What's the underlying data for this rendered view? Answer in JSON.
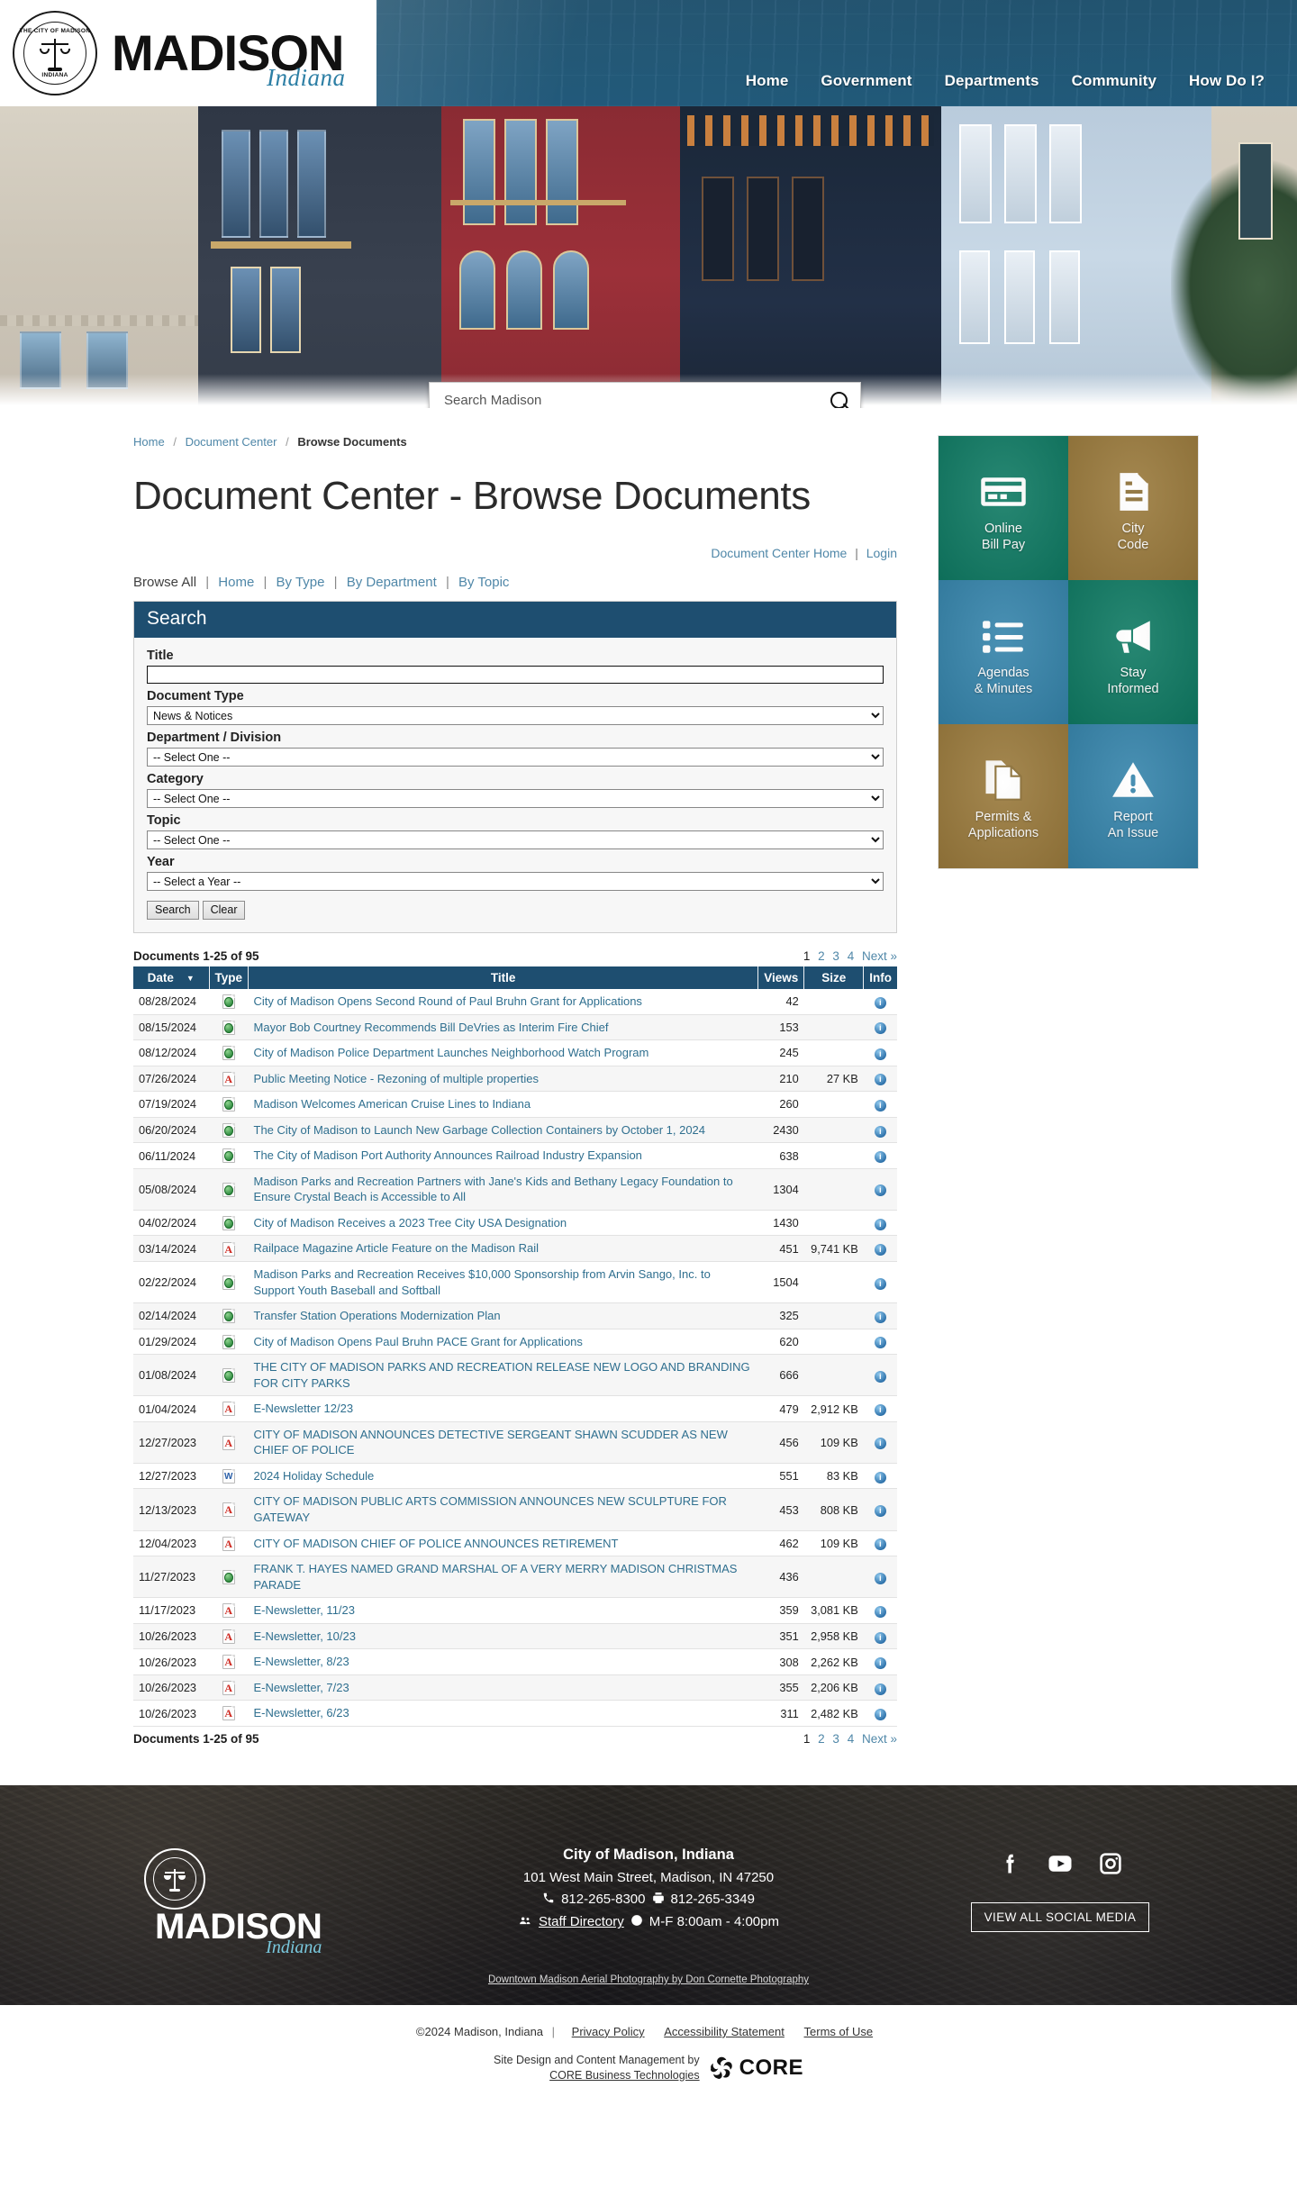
{
  "header": {
    "logo_title": "MADISON",
    "logo_subtitle": "Indiana",
    "seal_top_text": "THE CITY OF MADISON",
    "seal_bottom_text": "INDIANA",
    "nav": [
      {
        "label": "Home"
      },
      {
        "label": "Government"
      },
      {
        "label": "Departments"
      },
      {
        "label": "Community"
      },
      {
        "label": "How Do I?"
      }
    ]
  },
  "hero": {
    "search_placeholder": "Search Madison",
    "search_value": "",
    "search_icon": "search-icon"
  },
  "breadcrumb": {
    "items": [
      {
        "label": "Home",
        "current": false
      },
      {
        "label": "Document Center",
        "current": false
      },
      {
        "label": "Browse Documents",
        "current": true
      }
    ],
    "separator": "/"
  },
  "page": {
    "title": "Document Center - Browse Documents"
  },
  "doc_center_links": {
    "home": "Document Center Home",
    "separator": "|",
    "login": "Login"
  },
  "browse_nav": {
    "label": "Browse All",
    "separator": "|",
    "items": [
      {
        "label": "Home"
      },
      {
        "label": "By Type"
      },
      {
        "label": "By Department"
      },
      {
        "label": "By Topic"
      }
    ]
  },
  "search_panel": {
    "heading": "Search",
    "fields": [
      {
        "label": "Title",
        "type": "text",
        "value": "",
        "placeholder": ""
      },
      {
        "label": "Document Type",
        "type": "select",
        "value": "News & Notices"
      },
      {
        "label": "Department / Division",
        "type": "select",
        "value": "-- Select One --"
      },
      {
        "label": "Category",
        "type": "select",
        "value": "-- Select One --"
      },
      {
        "label": "Topic",
        "type": "select",
        "value": "-- Select One --"
      },
      {
        "label": "Year",
        "type": "select",
        "value": "-- Select a Year --"
      }
    ],
    "search_button": "Search",
    "clear_button": "Clear"
  },
  "results": {
    "count_label": "Documents 1-25 of 95",
    "pager": {
      "pages": [
        "1",
        "2",
        "3",
        "4"
      ],
      "current": "1",
      "next_label": "Next »"
    },
    "columns": {
      "date": "Date",
      "type": "Type",
      "title": "Title",
      "views": "Views",
      "size": "Size",
      "info": "Info"
    },
    "sort_indicator": "▼",
    "info_icon": "info-icon",
    "rows": [
      {
        "date": "08/28/2024",
        "icon": "html-file-icon",
        "title": "City of Madison Opens Second Round of Paul Bruhn Grant for Applications",
        "views": "42",
        "size": ""
      },
      {
        "date": "08/15/2024",
        "icon": "html-file-icon",
        "title": "Mayor Bob Courtney Recommends Bill DeVries as Interim Fire Chief",
        "views": "153",
        "size": ""
      },
      {
        "date": "08/12/2024",
        "icon": "html-file-icon",
        "title": "City of Madison Police Department Launches Neighborhood Watch Program",
        "views": "245",
        "size": ""
      },
      {
        "date": "07/26/2024",
        "icon": "pdf-file-icon",
        "title": "Public Meeting Notice - Rezoning of multiple properties",
        "views": "210",
        "size": "27 KB"
      },
      {
        "date": "07/19/2024",
        "icon": "html-file-icon",
        "title": "Madison Welcomes American Cruise Lines to Indiana",
        "views": "260",
        "size": ""
      },
      {
        "date": "06/20/2024",
        "icon": "html-file-icon",
        "title": "The City of Madison to Launch New Garbage Collection Containers by October 1, 2024",
        "views": "2430",
        "size": ""
      },
      {
        "date": "06/11/2024",
        "icon": "html-file-icon",
        "title": "The City of Madison Port Authority Announces Railroad Industry Expansion",
        "views": "638",
        "size": ""
      },
      {
        "date": "05/08/2024",
        "icon": "html-file-icon",
        "title": "Madison Parks and Recreation Partners with Jane's Kids and Bethany Legacy Foundation to Ensure Crystal Beach is Accessible to All",
        "views": "1304",
        "size": ""
      },
      {
        "date": "04/02/2024",
        "icon": "html-file-icon",
        "title": "City of Madison Receives a 2023 Tree City USA Designation",
        "views": "1430",
        "size": ""
      },
      {
        "date": "03/14/2024",
        "icon": "pdf-file-icon",
        "title": "Railpace Magazine Article Feature on the Madison Rail",
        "views": "451",
        "size": "9,741 KB"
      },
      {
        "date": "02/22/2024",
        "icon": "html-file-icon",
        "title": "Madison Parks and Recreation Receives $10,000 Sponsorship from Arvin Sango, Inc. to Support Youth Baseball and Softball",
        "views": "1504",
        "size": ""
      },
      {
        "date": "02/14/2024",
        "icon": "html-file-icon",
        "title": "Transfer Station Operations Modernization Plan",
        "views": "325",
        "size": ""
      },
      {
        "date": "01/29/2024",
        "icon": "html-file-icon",
        "title": "City of Madison Opens Paul Bruhn PACE Grant for Applications",
        "views": "620",
        "size": ""
      },
      {
        "date": "01/08/2024",
        "icon": "html-file-icon",
        "title": "THE CITY OF MADISON PARKS AND RECREATION RELEASE NEW LOGO AND BRANDING FOR CITY PARKS",
        "views": "666",
        "size": ""
      },
      {
        "date": "01/04/2024",
        "icon": "pdf-file-icon",
        "title": "E-Newsletter 12/23",
        "views": "479",
        "size": "2,912 KB"
      },
      {
        "date": "12/27/2023",
        "icon": "pdf-file-icon",
        "title": "CITY OF MADISON ANNOUNCES DETECTIVE SERGEANT SHAWN SCUDDER AS NEW CHIEF OF POLICE",
        "views": "456",
        "size": "109 KB"
      },
      {
        "date": "12/27/2023",
        "icon": "doc-file-icon",
        "title": "2024 Holiday Schedule",
        "views": "551",
        "size": "83 KB"
      },
      {
        "date": "12/13/2023",
        "icon": "pdf-file-icon",
        "title": "CITY OF MADISON PUBLIC ARTS COMMISSION ANNOUNCES NEW SCULPTURE FOR GATEWAY",
        "views": "453",
        "size": "808 KB"
      },
      {
        "date": "12/04/2023",
        "icon": "pdf-file-icon",
        "title": "CITY OF MADISON CHIEF OF POLICE ANNOUNCES RETIREMENT",
        "views": "462",
        "size": "109 KB"
      },
      {
        "date": "11/27/2023",
        "icon": "html-file-icon",
        "title": "FRANK T. HAYES NAMED GRAND MARSHAL OF A VERY MERRY MADISON CHRISTMAS PARADE",
        "views": "436",
        "size": ""
      },
      {
        "date": "11/17/2023",
        "icon": "pdf-file-icon",
        "title": "E-Newsletter, 11/23",
        "views": "359",
        "size": "3,081 KB"
      },
      {
        "date": "10/26/2023",
        "icon": "pdf-file-icon",
        "title": "E-Newsletter, 10/23",
        "views": "351",
        "size": "2,958 KB"
      },
      {
        "date": "10/26/2023",
        "icon": "pdf-file-icon",
        "title": "E-Newsletter, 8/23",
        "views": "308",
        "size": "2,262 KB"
      },
      {
        "date": "10/26/2023",
        "icon": "pdf-file-icon",
        "title": "E-Newsletter, 7/23",
        "views": "355",
        "size": "2,206 KB"
      },
      {
        "date": "10/26/2023",
        "icon": "pdf-file-icon",
        "title": "E-Newsletter, 6/23",
        "views": "311",
        "size": "2,482 KB"
      }
    ]
  },
  "quick_links": [
    {
      "label_line1": "Online",
      "label_line2": "Bill Pay",
      "icon": "credit-card-icon",
      "color": "#0f7a63"
    },
    {
      "label_line1": "City",
      "label_line2": "Code",
      "icon": "document-icon",
      "color": "#9a7a3c"
    },
    {
      "label_line1": "Agendas",
      "label_line2": "& Minutes",
      "icon": "list-icon",
      "color": "#3584ab"
    },
    {
      "label_line1": "Stay",
      "label_line2": "Informed",
      "icon": "megaphone-icon",
      "color": "#0f7a63"
    },
    {
      "label_line1": "Permits &",
      "label_line2": "Applications",
      "icon": "documents-copy-icon",
      "color": "#9a7a3c"
    },
    {
      "label_line1": "Report",
      "label_line2": "An Issue",
      "icon": "warning-triangle-icon",
      "color": "#3584ab"
    }
  ],
  "footer": {
    "logo_title": "MADISON",
    "logo_subtitle": "Indiana",
    "org_name": "City of Madison, Indiana",
    "address": "101 West Main Street, Madison, IN 47250",
    "phone": "812-265-8300",
    "fax": "812-265-3349",
    "staff_directory": "Staff Directory",
    "hours": "M-F 8:00am - 4:00pm",
    "phone_icon": "phone-icon",
    "fax_icon": "fax-icon",
    "people_icon": "people-icon",
    "clock_icon": "clock-icon",
    "socials": [
      {
        "name": "facebook-icon"
      },
      {
        "name": "youtube-icon"
      },
      {
        "name": "instagram-icon"
      }
    ],
    "view_all_social": "VIEW ALL SOCIAL MEDIA",
    "photo_credit": "Downtown Madison Aerial Photography by Don Cornette Photography"
  },
  "subfooter": {
    "copyright": "©2024 Madison, Indiana",
    "separator": "|",
    "links": [
      {
        "label": "Privacy Policy"
      },
      {
        "label": "Accessibility Statement"
      },
      {
        "label": "Terms of Use"
      }
    ],
    "credit_line1": "Site Design and Content Management by",
    "credit_line2": "CORE Business Technologies",
    "core_word": "CORE"
  }
}
